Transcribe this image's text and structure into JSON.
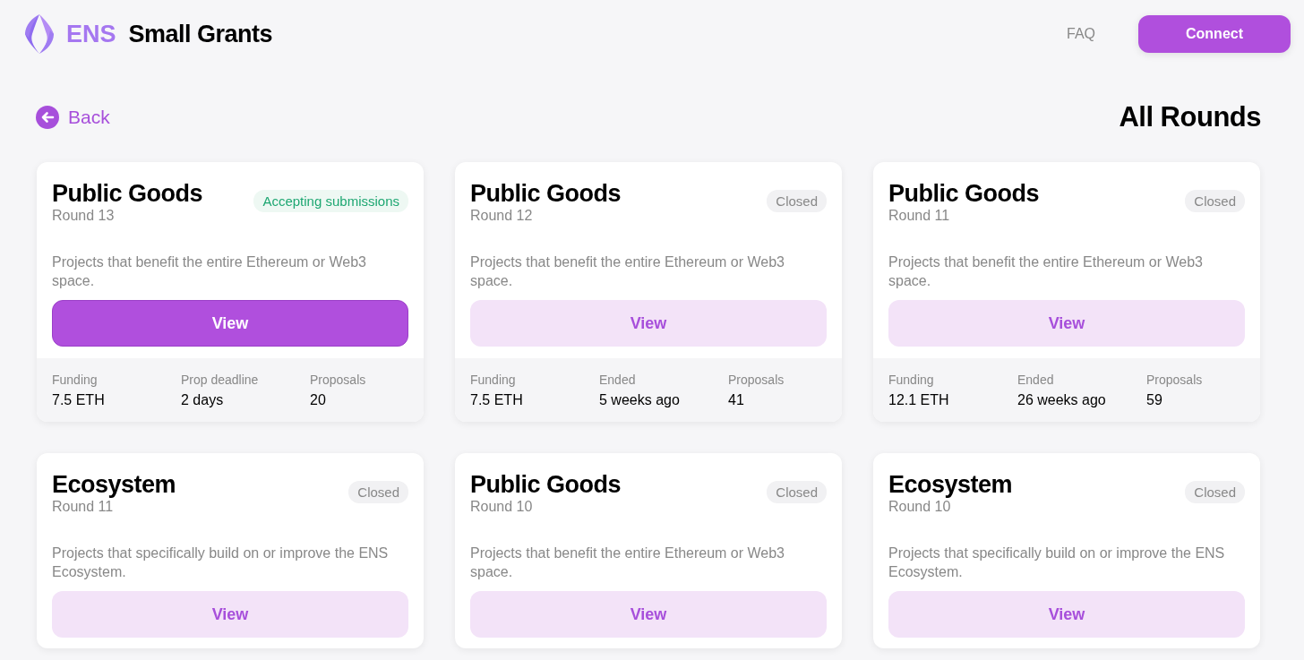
{
  "header": {
    "logo_text": "ENS",
    "title": "Small Grants",
    "nav": [
      {
        "label": "FAQ"
      }
    ],
    "connect_button": "Connect"
  },
  "back_link": "Back",
  "page_title": "All Rounds",
  "rounds": [
    {
      "title": "Public Goods",
      "round": "Round 13",
      "status": {
        "kind": "open",
        "label": "Accepting submissions"
      },
      "description": "Projects that benefit the entire Ethereum or Web3 space.",
      "button": "View",
      "stats": [
        {
          "label": "Funding",
          "value": "7.5 ETH"
        },
        {
          "label": "Prop deadline",
          "value": "2 days"
        },
        {
          "label": "Proposals",
          "value": "20"
        }
      ]
    },
    {
      "title": "Public Goods",
      "round": "Round 12",
      "status": {
        "kind": "closed",
        "label": "Closed"
      },
      "description": "Projects that benefit the entire Ethereum or Web3 space.",
      "button": "View",
      "stats": [
        {
          "label": "Funding",
          "value": "7.5 ETH"
        },
        {
          "label": "Ended",
          "value": "5 weeks ago"
        },
        {
          "label": "Proposals",
          "value": "41"
        }
      ]
    },
    {
      "title": "Public Goods",
      "round": "Round 11",
      "status": {
        "kind": "closed",
        "label": "Closed"
      },
      "description": "Projects that benefit the entire Ethereum or Web3 space.",
      "button": "View",
      "stats": [
        {
          "label": "Funding",
          "value": "12.1 ETH"
        },
        {
          "label": "Ended",
          "value": "26 weeks ago"
        },
        {
          "label": "Proposals",
          "value": "59"
        }
      ]
    },
    {
      "title": "Ecosystem",
      "round": "Round 11",
      "status": {
        "kind": "closed",
        "label": "Closed"
      },
      "description": "Projects that specifically build on or improve the ENS Ecosystem.",
      "button": "View"
    },
    {
      "title": "Public Goods",
      "round": "Round 10",
      "status": {
        "kind": "closed",
        "label": "Closed"
      },
      "description": "Projects that benefit the entire Ethereum or Web3 space.",
      "button": "View"
    },
    {
      "title": "Ecosystem",
      "round": "Round 10",
      "status": {
        "kind": "closed",
        "label": "Closed"
      },
      "description": "Projects that specifically build on or improve the ENS Ecosystem.",
      "button": "View"
    }
  ]
}
